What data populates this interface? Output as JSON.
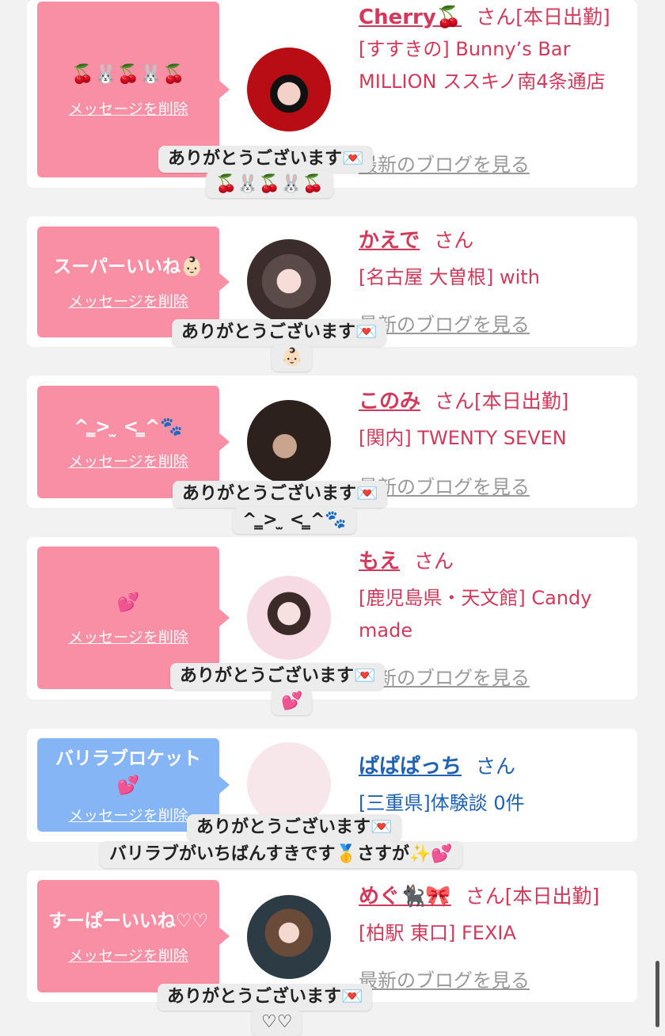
{
  "colors": {
    "bubble_pink": "#f98fa5",
    "bubble_blue": "#86b5f6",
    "name_pink": "#d23a5b",
    "name_blue": "#1f62b3"
  },
  "items": [
    {
      "message": "🍒🐰🍒🐰🍒",
      "delete": "メッセージを削除",
      "name": "Cherry🍒",
      "san": "さん[本日出勤]",
      "shop": "[すすきの] Bunny’s Bar MILLION ススキノ南4条通店",
      "blog": "最新のブログを見る",
      "thanks": "ありがとうございます💌",
      "reply": "🍒🐰🍒🐰🍒"
    },
    {
      "message": "スーパーいいね👶🏻",
      "delete": "メッセージを削除",
      "name": "かえで",
      "san": "さん",
      "shop": "[名古屋 大曽根] with",
      "blog": "最新のブログを見る",
      "thanks": "ありがとうございます💌",
      "reply": "👶🏻"
    },
    {
      "message": "^ ̳> ̫ < ̳^🐾",
      "delete": "メッセージを削除",
      "name": "このみ",
      "san": "さん[本日出勤]",
      "shop": "[関内] TWENTY SEVEN",
      "blog": "最新のブログを見る",
      "thanks": "ありがとうございます💌",
      "reply": "^ ̳> ̫ < ̳^🐾"
    },
    {
      "message": "💕",
      "delete": "メッセージを削除",
      "name": "もえ",
      "san": "さん",
      "shop": "[鹿児島県・天文館] Candy made",
      "blog": "最新のブログを見る",
      "thanks": "ありがとうございます💌",
      "reply": "💕"
    },
    {
      "message": "バリラブロケット💕",
      "delete": "メッセージを削除",
      "name": "ぱぱぱっち",
      "san": "さん",
      "shop": "[三重県]体験談 0件",
      "thanks": "ありがとうございます💌",
      "reply": "バリラブがいちばんすきです🥇さすが✨💕"
    },
    {
      "message": "すーぱーいいね♡♡",
      "delete": "メッセージを削除",
      "name": "めぐ🐈‍⬛🎀",
      "san": "さん[本日出勤]",
      "shop": "[柏駅 東口] FEXIA",
      "blog": "最新のブログを見る",
      "thanks": "ありがとうございます💌",
      "reply": "♡♡"
    }
  ]
}
